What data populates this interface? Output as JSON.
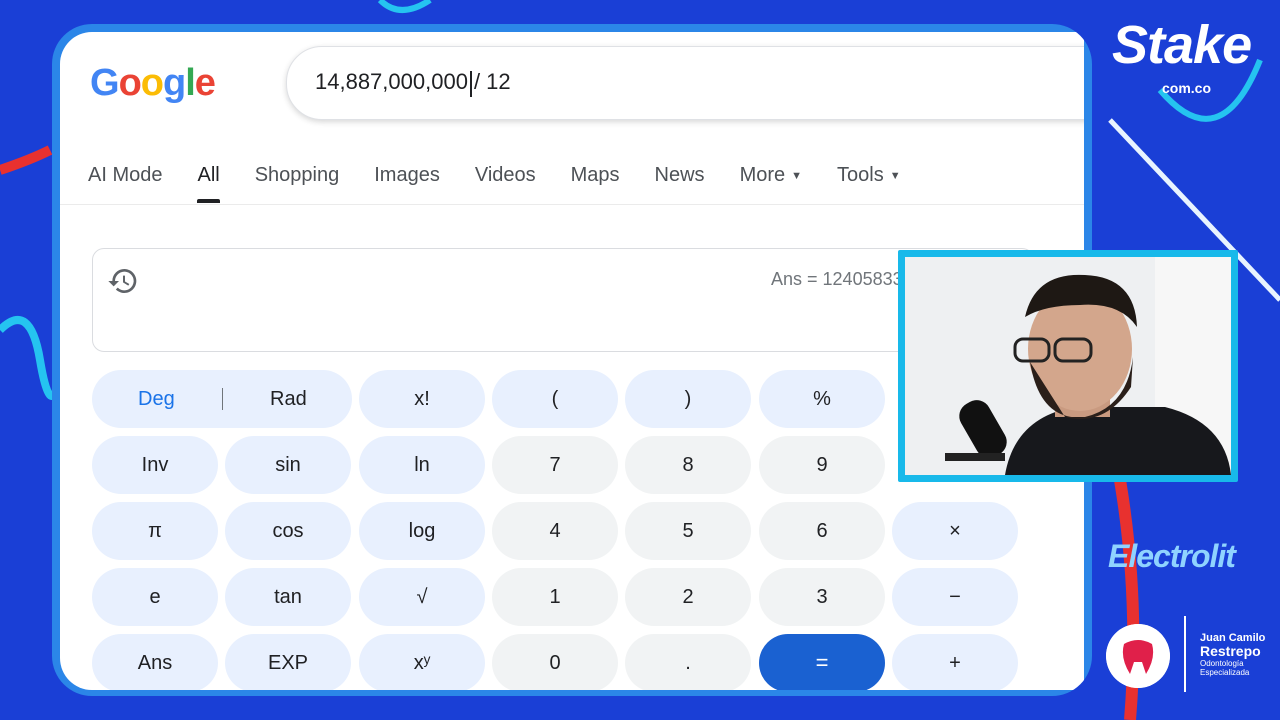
{
  "search": {
    "logo": [
      "G",
      "o",
      "o",
      "g",
      "l",
      "e"
    ],
    "query_before_caret": "14,887,000,000",
    "query_after_caret": "/ 12"
  },
  "tabs": [
    {
      "label": "AI Mode",
      "active": false,
      "dropdown": false
    },
    {
      "label": "All",
      "active": true,
      "dropdown": false
    },
    {
      "label": "Shopping",
      "active": false,
      "dropdown": false
    },
    {
      "label": "Images",
      "active": false,
      "dropdown": false
    },
    {
      "label": "Videos",
      "active": false,
      "dropdown": false
    },
    {
      "label": "Maps",
      "active": false,
      "dropdown": false
    },
    {
      "label": "News",
      "active": false,
      "dropdown": false
    },
    {
      "label": "More",
      "active": false,
      "dropdown": true
    },
    {
      "label": "Tools",
      "active": false,
      "dropdown": true
    }
  ],
  "calculator": {
    "history_icon": "history-icon",
    "ans_text": "Ans = 12405833",
    "deg_label": "Deg",
    "rad_label": "Rad",
    "keys": {
      "fact": "x!",
      "lparen": "(",
      "rparen": ")",
      "percent": "%",
      "inv": "Inv",
      "sin": "sin",
      "ln": "ln",
      "seven": "7",
      "eight": "8",
      "nine": "9",
      "pi": "π",
      "cos": "cos",
      "log": "log",
      "four": "4",
      "five": "5",
      "six": "6",
      "times": "×",
      "e": "e",
      "tan": "tan",
      "sqrt": "√",
      "one": "1",
      "two": "2",
      "three": "3",
      "minus": "−",
      "ans": "Ans",
      "exp": "EXP",
      "pow": "xʸ",
      "zero": "0",
      "dot": ".",
      "equals": "=",
      "plus": "+"
    }
  },
  "overlay": {
    "stake_logo": "Stake",
    "stake_domain": "com.co",
    "electrolit_logo": "Electrolit",
    "jcr_name_line1": "Juan Camilo",
    "jcr_name_line2": "Restrepo",
    "jcr_sub_line1": "Odontología",
    "jcr_sub_line2": "Especializada"
  },
  "colors": {
    "background": "#1a3fd6",
    "frame": "#2b86e8",
    "equals_button": "#1a61d1",
    "fn_button": "#e8f0fe",
    "num_button": "#f1f3f4",
    "cam_border": "#18b9ea"
  }
}
